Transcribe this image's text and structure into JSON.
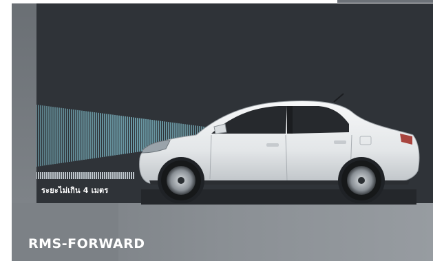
{
  "feature": {
    "title": "RMS-FORWARD",
    "range_label": "ระยะไม่เกิน 4 เมตร"
  },
  "colors": {
    "background_dark": "#2f3338",
    "panel_grey": "#878c91",
    "beam_cyan": "#8fd6e6",
    "car_white": "#eceff1"
  },
  "icons": {
    "sensor_beam": "ultrasonic-beam-graphic",
    "vehicle": "sedan-side-view"
  }
}
